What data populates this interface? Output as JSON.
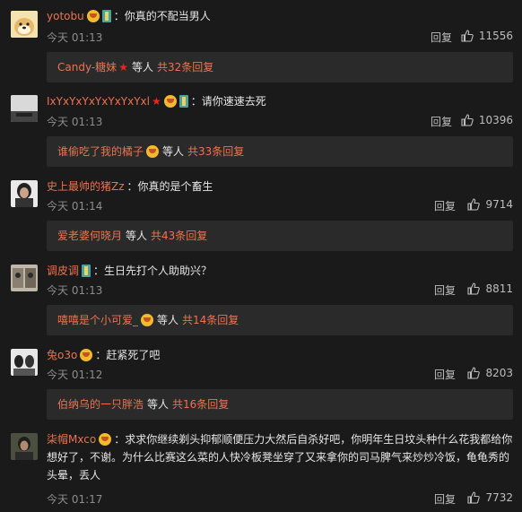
{
  "like_icon": "thumbs-up-icon",
  "reply_label": "回复",
  "comments": [
    {
      "user": "yotobu",
      "badges": [
        "emoji-badge",
        "vip-badge"
      ],
      "text": "你真的不配当男人",
      "time": "今天 01:13",
      "likes": "11556",
      "sub": {
        "name": "Candy-糖妹",
        "badges": [
          "star-badge"
        ],
        "others": "等人",
        "count": "共32条回复"
      }
    },
    {
      "user": "IxYxYxYxYxYxYxYxl",
      "badges": [
        "star-badge",
        "emoji-badge",
        "vip-badge"
      ],
      "text": "请你速速去死",
      "time": "今天 01:13",
      "likes": "10396",
      "sub": {
        "name": "谁偷吃了我的橘子",
        "badges": [
          "emoji-badge"
        ],
        "others": "等人",
        "count": "共33条回复"
      }
    },
    {
      "user": "史上最帅的猪Zz",
      "badges": [],
      "text": "你真的是个畜生",
      "time": "今天 01:14",
      "likes": "9714",
      "sub": {
        "name": "爱老婆何晓月",
        "badges": [],
        "others": "等人",
        "count": "共43条回复"
      }
    },
    {
      "user": "调皮调",
      "badges": [
        "vip-badge"
      ],
      "text": "生日先打个人助助兴？",
      "time": "今天 01:13",
      "likes": "8811",
      "sub": {
        "name": "嘻嘻是个小可爱_",
        "badges": [
          "emoji-badge"
        ],
        "others": "等人",
        "count": "共14条回复"
      }
    },
    {
      "user": "兔o3o",
      "badges": [
        "emoji-badge"
      ],
      "text": "赶紧死了吧",
      "time": "今天 01:12",
      "likes": "8203",
      "sub": {
        "name": "伯纳乌的一只胖浩",
        "badges": [],
        "others": "等人",
        "count": "共16条回复"
      }
    },
    {
      "user": "柒帽Mxco",
      "badges": [
        "emoji-badge"
      ],
      "text": "求求你继续剃头抑郁顺便压力大然后自杀好吧，你明年生日坟头种什么花我都给你",
      "text_line2": "想好了，不谢。为什么比赛这么菜的人快冷板凳坐穿了又来拿你的司马脾气来炒炒冷饭，龟龟秀的",
      "text_line3": "头晕，丢人",
      "time": "今天 01:17",
      "likes": "7732"
    }
  ]
}
